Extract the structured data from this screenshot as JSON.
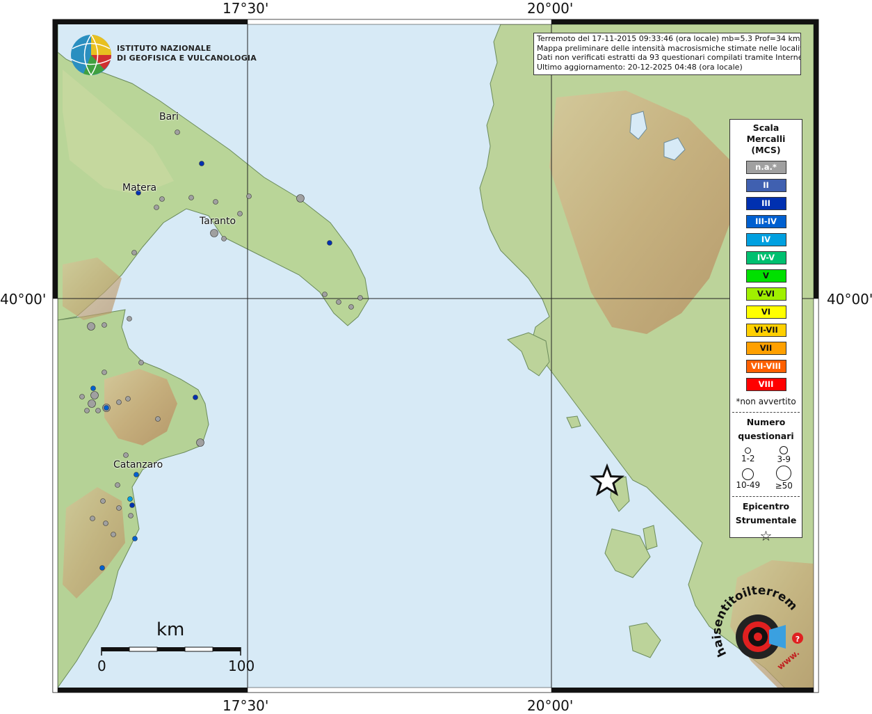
{
  "institute": {
    "name_line1": "ISTITUTO NAZIONALE",
    "name_line2": "DI GEOFISICA E VULCANOLOGIA"
  },
  "coordinates": {
    "lon_left": "17°30'",
    "lon_right": "20°00'",
    "lat": "40°00'"
  },
  "info": {
    "line1": "Terremoto del 17-11-2015 09:33:46 (ora locale) mb=5.3 Prof=34 km",
    "line2": "Mappa preliminare delle intensità macrosismiche stimate nelle località",
    "line3": "Dati non verificati estratti da 93 questionari compilati tramite Internet.",
    "line4": "Ultimo aggiornamento: 20-12-2025 04:48 (ora locale)"
  },
  "cities": [
    "Bari",
    "Matera",
    "Taranto",
    "Catanzaro"
  ],
  "legend": {
    "title1": "Scala",
    "title2": "Mercalli",
    "title3": "(MCS)",
    "scale": [
      {
        "label": "n.a.*",
        "color": "#a0a0a0"
      },
      {
        "label": "II",
        "color": "#4060b0"
      },
      {
        "label": "III",
        "color": "#0030b0"
      },
      {
        "label": "III-IV",
        "color": "#0060d0"
      },
      {
        "label": "IV",
        "color": "#00a0e0"
      },
      {
        "label": "IV-V",
        "color": "#00c070"
      },
      {
        "label": "V",
        "color": "#00e000"
      },
      {
        "label": "V-VI",
        "color": "#a0f000"
      },
      {
        "label": "VI",
        "color": "#ffff00"
      },
      {
        "label": "VI-VII",
        "color": "#ffd000"
      },
      {
        "label": "VII",
        "color": "#ffa000"
      },
      {
        "label": "VII-VIII",
        "color": "#ff6000"
      },
      {
        "label": "VIII",
        "color": "#ff0000"
      }
    ],
    "note": "*non avvertito",
    "count_title1": "Numero",
    "count_title2": "questionari",
    "sizes": [
      "1-2",
      "3-9",
      "10-49",
      "≥50"
    ],
    "epi_title1": "Epicentro",
    "epi_title2": "Strumentale"
  },
  "scalebar": {
    "unit": "km",
    "start": "0",
    "end": "100"
  },
  "haisentito": {
    "text": "haisentitoilterremoto.it",
    "www": "www."
  }
}
